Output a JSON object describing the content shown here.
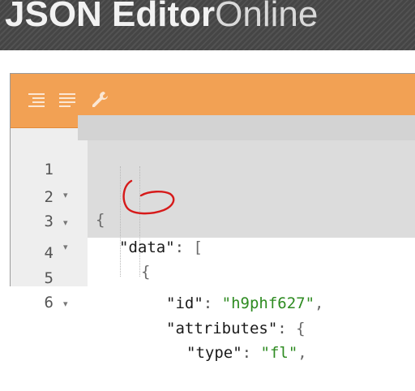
{
  "app": {
    "title_strong": "JSON Editor",
    "title_light": "Online"
  },
  "menu": {
    "buttons": [
      {
        "icon": "format-icon"
      },
      {
        "icon": "compact-icon"
      },
      {
        "icon": "wrench-icon"
      }
    ]
  },
  "colors": {
    "header_bg": "#454545",
    "menu_bg": "#f2a154",
    "string_value": "#2e8b21",
    "annotation": "#d61a1a"
  },
  "editor": {
    "lines": [
      {
        "num": "1",
        "fold": "▾",
        "indent": "",
        "key": "",
        "sep": "",
        "value": "",
        "rest": "{"
      },
      {
        "num": "2",
        "fold": "▾",
        "indent": "  ",
        "key": "\"data\"",
        "sep": ": ",
        "value": "",
        "rest": "["
      },
      {
        "num": "3",
        "fold": "▾",
        "indent": "    ",
        "key": "",
        "sep": "",
        "value": "",
        "rest": "{"
      },
      {
        "num": "4",
        "fold": "",
        "indent": "      ",
        "key": "\"id\"",
        "sep": ": ",
        "value": "\"h9phf627\"",
        "rest": ","
      },
      {
        "num": "5",
        "fold": "▾",
        "indent": "      ",
        "key": "\"attributes\"",
        "sep": ": ",
        "value": "",
        "rest": "{"
      },
      {
        "num": "6",
        "fold": "",
        "indent": "        ",
        "key": "\"type\"",
        "sep": ": ",
        "value": "\"fl\"",
        "rest": ","
      }
    ]
  }
}
